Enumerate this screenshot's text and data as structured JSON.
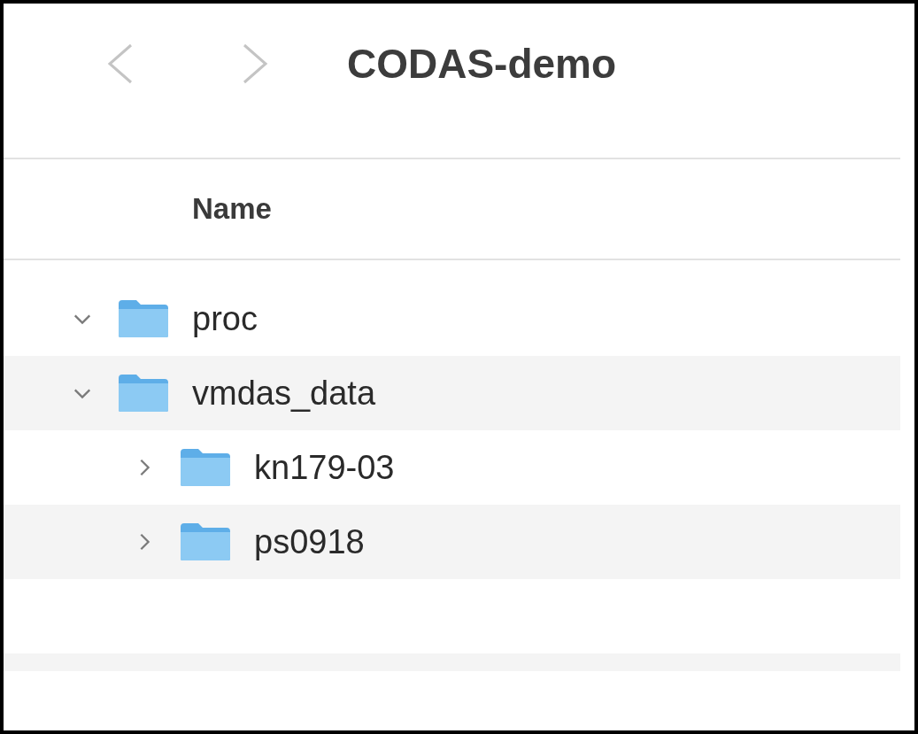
{
  "window": {
    "title": "CODAS-demo"
  },
  "columns": [
    {
      "label": "Name"
    }
  ],
  "tree": [
    {
      "name": "proc",
      "expanded": true
    },
    {
      "name": "vmdas_data",
      "expanded": true,
      "children": [
        {
          "name": "kn179-03",
          "expanded": false
        },
        {
          "name": "ps0918",
          "expanded": false
        }
      ]
    }
  ]
}
